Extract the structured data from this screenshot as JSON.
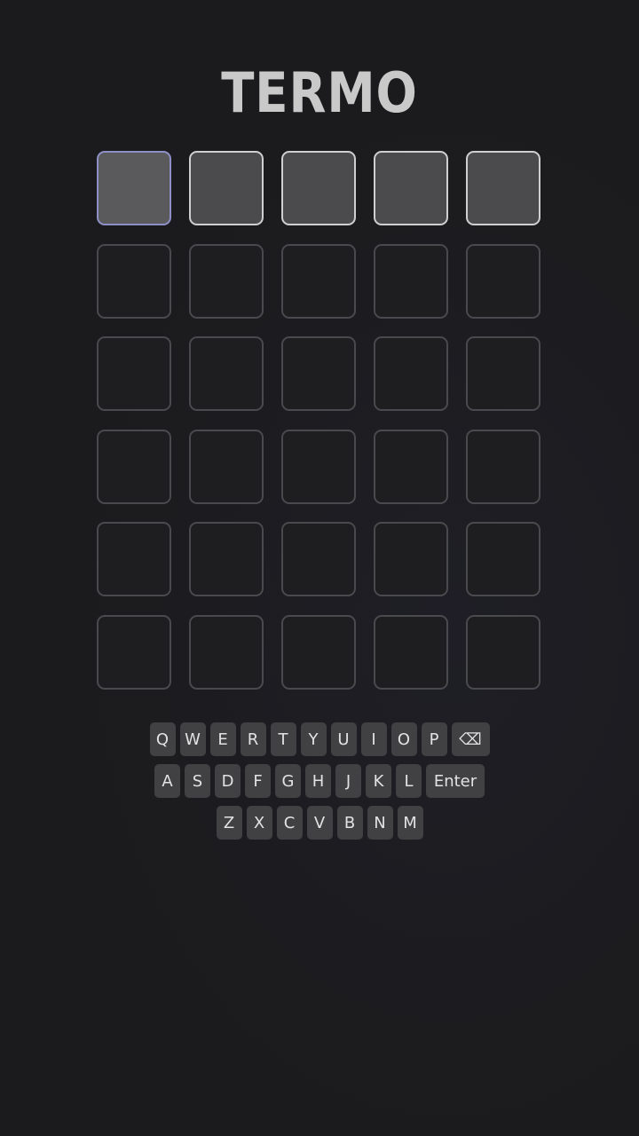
{
  "app": {
    "title": "TERMO"
  },
  "board": {
    "rows": 6,
    "cols": 5,
    "active_row": 0,
    "selected_col": 0
  },
  "keyboard": {
    "row1": [
      "Q",
      "W",
      "E",
      "R",
      "T",
      "Y",
      "U",
      "I",
      "O",
      "P"
    ],
    "backspace_label": "⌫",
    "row2": [
      "A",
      "S",
      "D",
      "F",
      "G",
      "H",
      "J",
      "K",
      "L"
    ],
    "enter_label": "Enter",
    "row3": [
      "Z",
      "X",
      "C",
      "V",
      "B",
      "N",
      "M"
    ]
  },
  "colors": {
    "background": "#1b1b1d",
    "tile_empty": "#1e1e21",
    "tile_active": "#4b4b4e",
    "tile_selected_border": "#8f8fc8",
    "key_bg": "#414144"
  }
}
